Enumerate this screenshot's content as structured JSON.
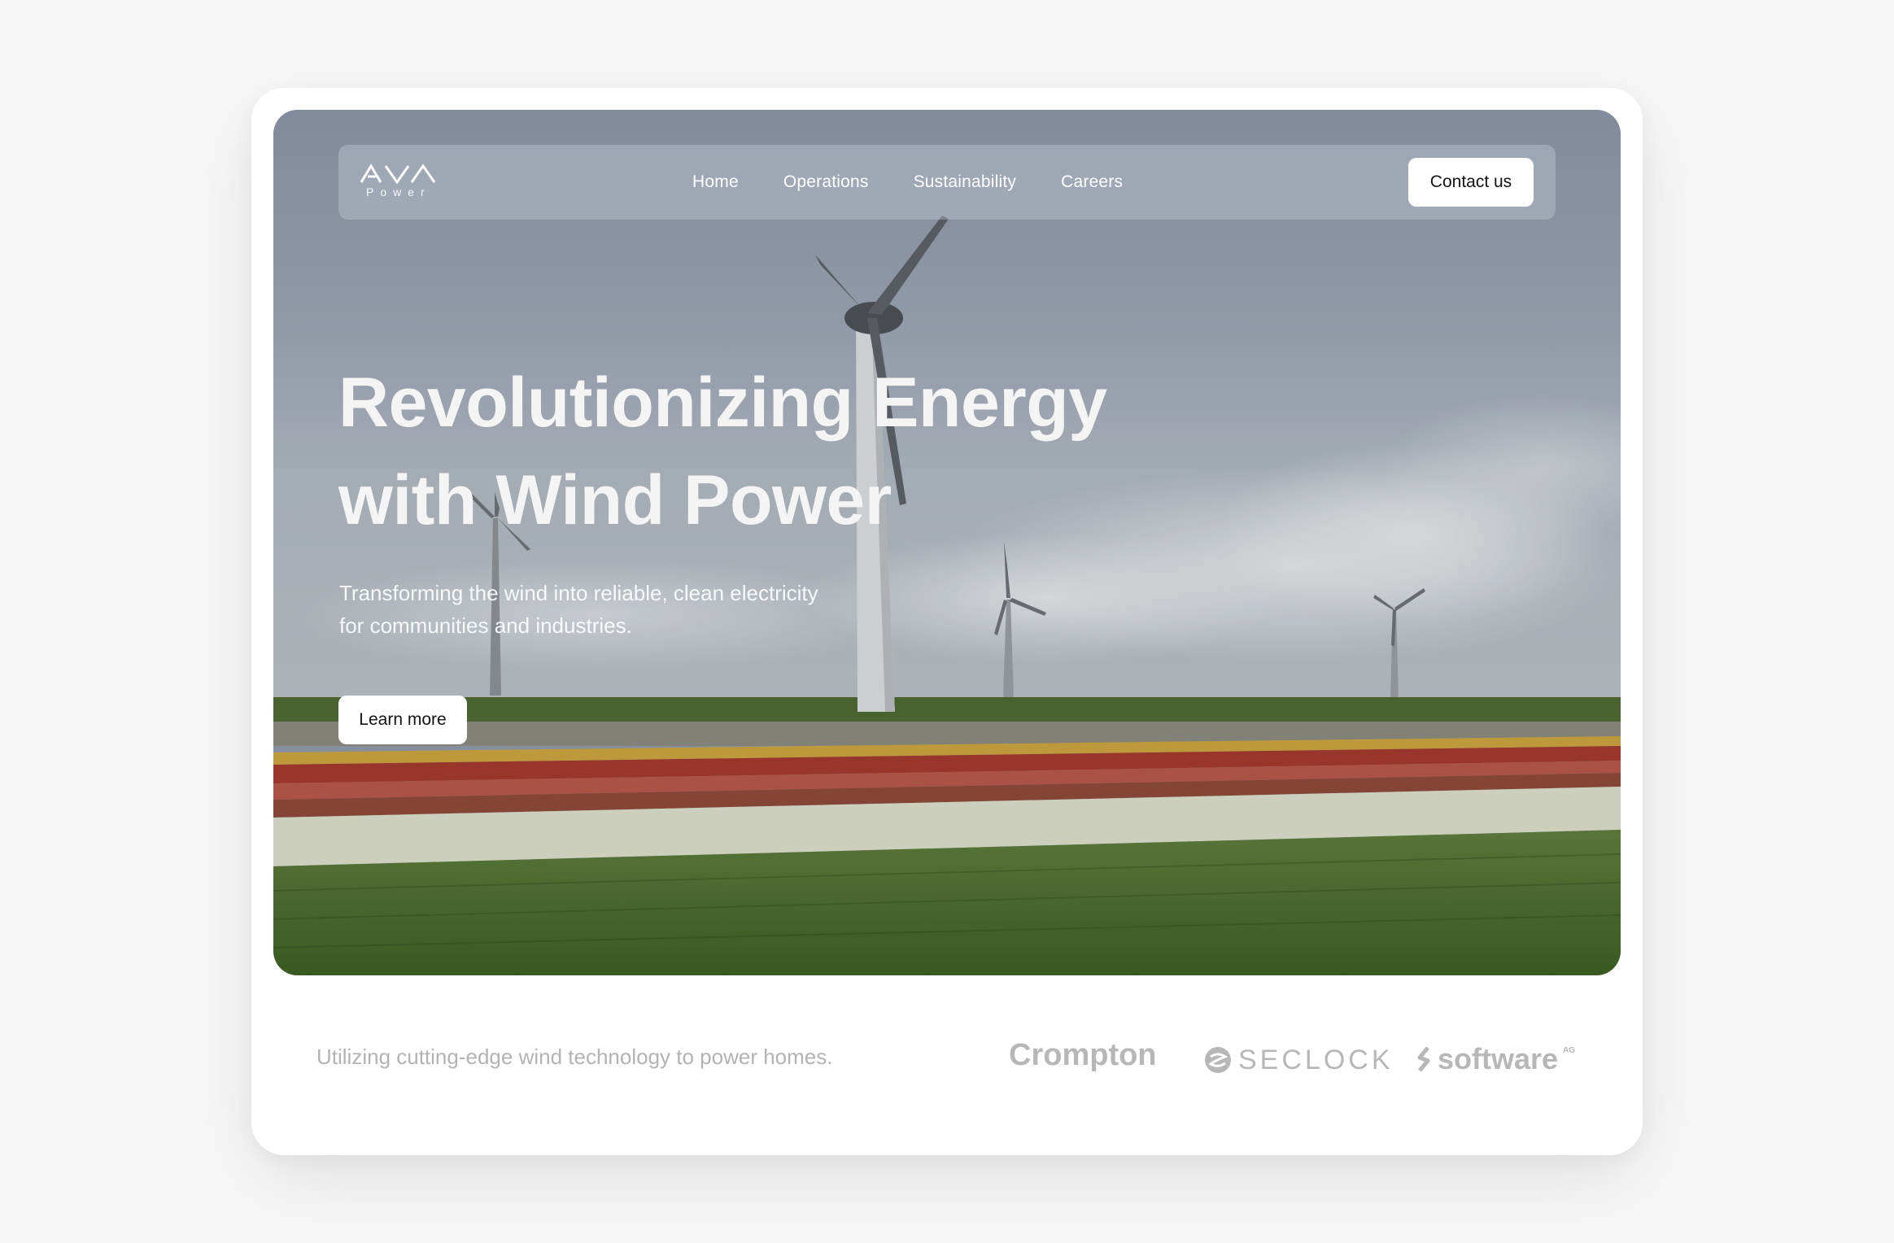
{
  "brand": {
    "logo_text": "AVA",
    "logo_sub": "Power"
  },
  "nav": {
    "items": [
      {
        "label": "Home"
      },
      {
        "label": "Operations"
      },
      {
        "label": "Sustainability"
      },
      {
        "label": "Careers"
      }
    ],
    "cta_label": "Contact us"
  },
  "hero": {
    "title_line1": "Revolutionizing Energy",
    "title_line2": "with Wind Power",
    "subtitle_line1": "Transforming the wind into reliable, clean electricity",
    "subtitle_line2": "for communities and industries.",
    "button_label": "Learn more"
  },
  "footer": {
    "tagline": "Utilizing cutting-edge wind technology to power homes.",
    "partners": [
      {
        "name": "Crompton"
      },
      {
        "name": "SECLOCK"
      },
      {
        "name": "software",
        "suffix": "AG"
      }
    ]
  },
  "colors": {
    "page_bg": "#f7f7f7",
    "card_bg": "#ffffff",
    "sky": "#8e98a8",
    "field_green": "#4c6e2c",
    "muted_text": "#b3b3b3"
  }
}
